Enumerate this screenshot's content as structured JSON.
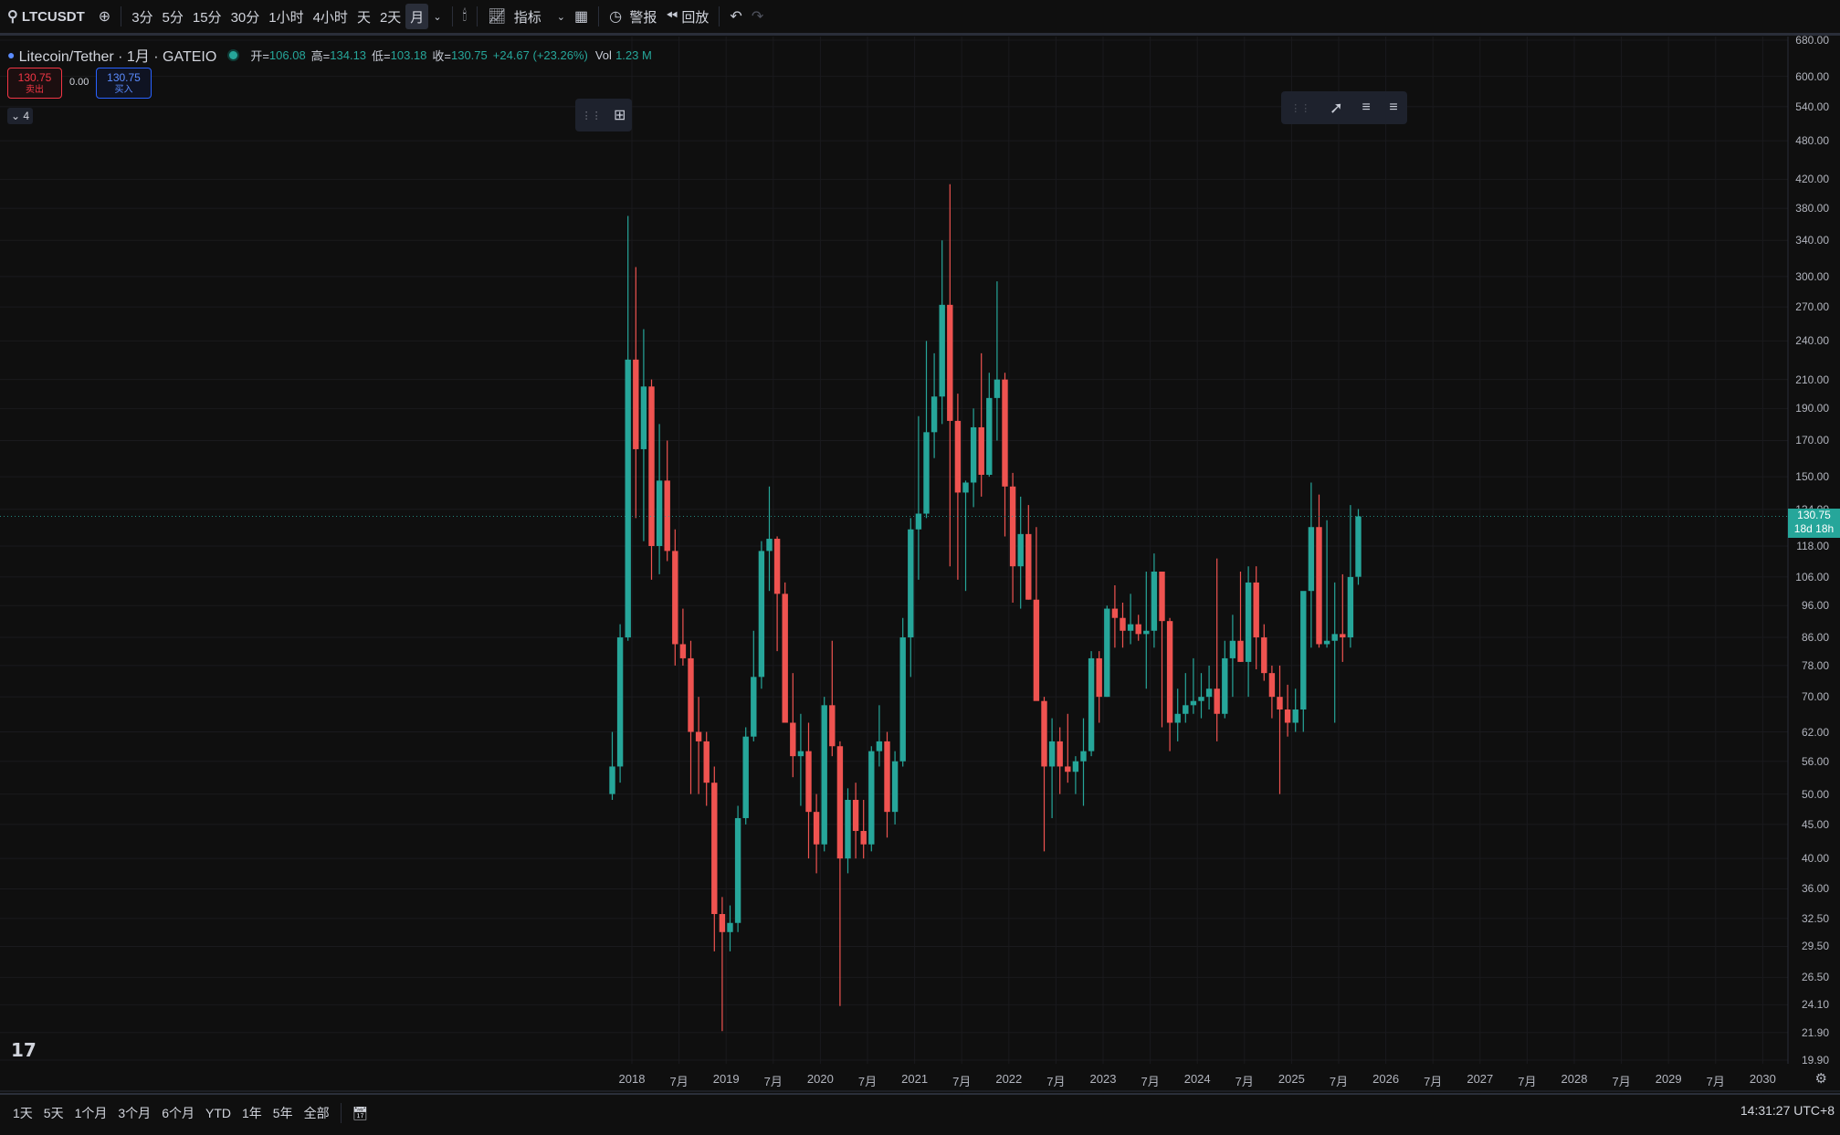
{
  "toolbar": {
    "symbol": "LTCUSDT",
    "intervals": [
      "3分",
      "5分",
      "15分",
      "30分",
      "1小时",
      "4小时",
      "天",
      "2天",
      "月"
    ],
    "active_interval": "月",
    "indicators_label": "指标",
    "alerts_label": "警报",
    "replay_label": "回放"
  },
  "legend": {
    "title": "Litecoin/Tether · 1月 · GATEIO",
    "open_k": "开=",
    "open_v": "106.08",
    "high_k": "高=",
    "high_v": "134.13",
    "low_k": "低=",
    "low_v": "103.18",
    "close_k": "收=",
    "close_v": "130.75",
    "change": "+24.67 (+23.26%)",
    "vol_k": "Vol",
    "vol_v": "1.23 M"
  },
  "trade": {
    "sell_price": "130.75",
    "sell_label": "卖出",
    "spread": "0.00",
    "buy_price": "130.75",
    "buy_label": "买入",
    "collapse_count": "4"
  },
  "price_axis": [
    "680.00",
    "600.00",
    "540.00",
    "480.00",
    "420.00",
    "380.00",
    "340.00",
    "300.00",
    "270.00",
    "240.00",
    "210.00",
    "190.00",
    "170.00",
    "150.00",
    "134.00",
    "118.00",
    "106.00",
    "96.00",
    "86.00",
    "78.00",
    "70.00",
    "62.00",
    "56.00",
    "50.00",
    "45.00",
    "40.00",
    "36.00",
    "32.50",
    "29.50",
    "26.50",
    "24.10",
    "21.90",
    "19.90"
  ],
  "last_price": {
    "price": "130.75",
    "countdown": "18d 18h"
  },
  "time_axis": [
    "2018",
    "7月",
    "2019",
    "7月",
    "2020",
    "7月",
    "2021",
    "7月",
    "2022",
    "7月",
    "2023",
    "7月",
    "2024",
    "7月",
    "2025",
    "7月",
    "2026",
    "7月",
    "2027",
    "7月",
    "2028",
    "7月",
    "2029",
    "7月",
    "2030"
  ],
  "bottom": {
    "ranges": [
      "1天",
      "5天",
      "1个月",
      "3个月",
      "6个月",
      "YTD",
      "1年",
      "5年",
      "全部"
    ],
    "clock": "14:31:27 UTC+8"
  },
  "colors": {
    "up": "#26a69a",
    "down": "#ef5350",
    "bg": "#0f0f0f"
  },
  "chart_data": {
    "type": "candlestick",
    "title": "Litecoin/Tether · 1月 · GATEIO",
    "yscale": "log",
    "ylim": [
      19.9,
      680
    ],
    "candles": [
      {
        "t": "2017-10",
        "o": 50,
        "h": 62,
        "l": 49,
        "c": 55
      },
      {
        "t": "2017-11",
        "o": 55,
        "h": 90,
        "l": 52,
        "c": 86
      },
      {
        "t": "2017-12",
        "o": 86,
        "h": 370,
        "l": 85,
        "c": 225
      },
      {
        "t": "2018-01",
        "o": 225,
        "h": 310,
        "l": 130,
        "c": 165
      },
      {
        "t": "2018-02",
        "o": 165,
        "h": 250,
        "l": 120,
        "c": 205
      },
      {
        "t": "2018-03",
        "o": 205,
        "h": 210,
        "l": 105,
        "c": 118
      },
      {
        "t": "2018-04",
        "o": 118,
        "h": 180,
        "l": 107,
        "c": 148
      },
      {
        "t": "2018-05",
        "o": 148,
        "h": 170,
        "l": 112,
        "c": 116
      },
      {
        "t": "2018-06",
        "o": 116,
        "h": 125,
        "l": 78,
        "c": 84
      },
      {
        "t": "2018-07",
        "o": 84,
        "h": 95,
        "l": 78,
        "c": 80
      },
      {
        "t": "2018-08",
        "o": 80,
        "h": 85,
        "l": 50,
        "c": 62
      },
      {
        "t": "2018-09",
        "o": 62,
        "h": 70,
        "l": 50,
        "c": 60
      },
      {
        "t": "2018-10",
        "o": 60,
        "h": 62,
        "l": 48,
        "c": 52
      },
      {
        "t": "2018-11",
        "o": 52,
        "h": 55,
        "l": 29,
        "c": 33
      },
      {
        "t": "2018-12",
        "o": 33,
        "h": 35,
        "l": 22,
        "c": 31
      },
      {
        "t": "2019-01",
        "o": 31,
        "h": 34,
        "l": 29,
        "c": 32
      },
      {
        "t": "2019-02",
        "o": 32,
        "h": 48,
        "l": 31,
        "c": 46
      },
      {
        "t": "2019-03",
        "o": 46,
        "h": 63,
        "l": 45,
        "c": 61
      },
      {
        "t": "2019-04",
        "o": 61,
        "h": 88,
        "l": 60,
        "c": 75
      },
      {
        "t": "2019-05",
        "o": 75,
        "h": 120,
        "l": 72,
        "c": 116
      },
      {
        "t": "2019-06",
        "o": 116,
        "h": 145,
        "l": 101,
        "c": 121
      },
      {
        "t": "2019-07",
        "o": 121,
        "h": 122,
        "l": 82,
        "c": 100
      },
      {
        "t": "2019-08",
        "o": 100,
        "h": 104,
        "l": 67,
        "c": 64
      },
      {
        "t": "2019-09",
        "o": 64,
        "h": 76,
        "l": 53,
        "c": 57
      },
      {
        "t": "2019-10",
        "o": 57,
        "h": 66,
        "l": 48,
        "c": 58
      },
      {
        "t": "2019-11",
        "o": 58,
        "h": 64,
        "l": 40,
        "c": 47
      },
      {
        "t": "2019-12",
        "o": 47,
        "h": 50,
        "l": 38,
        "c": 42
      },
      {
        "t": "2020-01",
        "o": 42,
        "h": 70,
        "l": 41,
        "c": 68
      },
      {
        "t": "2020-02",
        "o": 68,
        "h": 85,
        "l": 57,
        "c": 59
      },
      {
        "t": "2020-03",
        "o": 59,
        "h": 60,
        "l": 24,
        "c": 40
      },
      {
        "t": "2020-04",
        "o": 40,
        "h": 51,
        "l": 38,
        "c": 49
      },
      {
        "t": "2020-05",
        "o": 49,
        "h": 52,
        "l": 40,
        "c": 44
      },
      {
        "t": "2020-06",
        "o": 44,
        "h": 49,
        "l": 40,
        "c": 42
      },
      {
        "t": "2020-07",
        "o": 42,
        "h": 59,
        "l": 41,
        "c": 58
      },
      {
        "t": "2020-08",
        "o": 58,
        "h": 68,
        "l": 55,
        "c": 60
      },
      {
        "t": "2020-09",
        "o": 60,
        "h": 62,
        "l": 43,
        "c": 47
      },
      {
        "t": "2020-10",
        "o": 47,
        "h": 58,
        "l": 45,
        "c": 56
      },
      {
        "t": "2020-11",
        "o": 56,
        "h": 92,
        "l": 55,
        "c": 86
      },
      {
        "t": "2020-12",
        "o": 86,
        "h": 130,
        "l": 75,
        "c": 125
      },
      {
        "t": "2021-01",
        "o": 125,
        "h": 185,
        "l": 105,
        "c": 132
      },
      {
        "t": "2021-02",
        "o": 132,
        "h": 240,
        "l": 130,
        "c": 175
      },
      {
        "t": "2021-03",
        "o": 175,
        "h": 230,
        "l": 160,
        "c": 198
      },
      {
        "t": "2021-04",
        "o": 198,
        "h": 340,
        "l": 180,
        "c": 272
      },
      {
        "t": "2021-05",
        "o": 272,
        "h": 413,
        "l": 110,
        "c": 182
      },
      {
        "t": "2021-06",
        "o": 182,
        "h": 200,
        "l": 105,
        "c": 142
      },
      {
        "t": "2021-07",
        "o": 142,
        "h": 148,
        "l": 101,
        "c": 147
      },
      {
        "t": "2021-08",
        "o": 147,
        "h": 190,
        "l": 135,
        "c": 178
      },
      {
        "t": "2021-09",
        "o": 178,
        "h": 230,
        "l": 140,
        "c": 151
      },
      {
        "t": "2021-10",
        "o": 151,
        "h": 215,
        "l": 150,
        "c": 197
      },
      {
        "t": "2021-11",
        "o": 197,
        "h": 295,
        "l": 170,
        "c": 210
      },
      {
        "t": "2021-12",
        "o": 210,
        "h": 215,
        "l": 122,
        "c": 145
      },
      {
        "t": "2022-01",
        "o": 145,
        "h": 152,
        "l": 97,
        "c": 110
      },
      {
        "t": "2022-02",
        "o": 110,
        "h": 140,
        "l": 95,
        "c": 123
      },
      {
        "t": "2022-03",
        "o": 123,
        "h": 136,
        "l": 98,
        "c": 98
      },
      {
        "t": "2022-04",
        "o": 98,
        "h": 126,
        "l": 91,
        "c": 69
      },
      {
        "t": "2022-05",
        "o": 69,
        "h": 70,
        "l": 41,
        "c": 55
      },
      {
        "t": "2022-06",
        "o": 55,
        "h": 65,
        "l": 46,
        "c": 60
      },
      {
        "t": "2022-07",
        "o": 60,
        "h": 63,
        "l": 50,
        "c": 55
      },
      {
        "t": "2022-08",
        "o": 55,
        "h": 66,
        "l": 52,
        "c": 54
      },
      {
        "t": "2022-09",
        "o": 54,
        "h": 57,
        "l": 50,
        "c": 56
      },
      {
        "t": "2022-10",
        "o": 56,
        "h": 65,
        "l": 48,
        "c": 58
      },
      {
        "t": "2022-11",
        "o": 58,
        "h": 82,
        "l": 57,
        "c": 80
      },
      {
        "t": "2022-12",
        "o": 80,
        "h": 82,
        "l": 64,
        "c": 70
      },
      {
        "t": "2023-01",
        "o": 70,
        "h": 96,
        "l": 70,
        "c": 95
      },
      {
        "t": "2023-02",
        "o": 95,
        "h": 103,
        "l": 83,
        "c": 92
      },
      {
        "t": "2023-03",
        "o": 92,
        "h": 97,
        "l": 83,
        "c": 88
      },
      {
        "t": "2023-04",
        "o": 88,
        "h": 100,
        "l": 84,
        "c": 90
      },
      {
        "t": "2023-05",
        "o": 90,
        "h": 93,
        "l": 85,
        "c": 87
      },
      {
        "t": "2023-06",
        "o": 87,
        "h": 108,
        "l": 72,
        "c": 88
      },
      {
        "t": "2023-07",
        "o": 88,
        "h": 115,
        "l": 83,
        "c": 108
      },
      {
        "t": "2023-08",
        "o": 108,
        "h": 108,
        "l": 63,
        "c": 91
      },
      {
        "t": "2023-09",
        "o": 91,
        "h": 92,
        "l": 58,
        "c": 64
      },
      {
        "t": "2023-10",
        "o": 64,
        "h": 72,
        "l": 60,
        "c": 66
      },
      {
        "t": "2023-11",
        "o": 66,
        "h": 76,
        "l": 64,
        "c": 68
      },
      {
        "t": "2023-12",
        "o": 68,
        "h": 80,
        "l": 66,
        "c": 69
      },
      {
        "t": "2024-01",
        "o": 69,
        "h": 76,
        "l": 65,
        "c": 70
      },
      {
        "t": "2024-02",
        "o": 70,
        "h": 78,
        "l": 67,
        "c": 72
      },
      {
        "t": "2024-03",
        "o": 72,
        "h": 113,
        "l": 60,
        "c": 66
      },
      {
        "t": "2024-04",
        "o": 66,
        "h": 85,
        "l": 65,
        "c": 80
      },
      {
        "t": "2024-05",
        "o": 80,
        "h": 93,
        "l": 70,
        "c": 85
      },
      {
        "t": "2024-06",
        "o": 85,
        "h": 108,
        "l": 79,
        "c": 79
      },
      {
        "t": "2024-07",
        "o": 79,
        "h": 110,
        "l": 70,
        "c": 104
      },
      {
        "t": "2024-08",
        "o": 104,
        "h": 110,
        "l": 77,
        "c": 86
      },
      {
        "t": "2024-09",
        "o": 86,
        "h": 90,
        "l": 74,
        "c": 76
      },
      {
        "t": "2024-10",
        "o": 76,
        "h": 78,
        "l": 65,
        "c": 70
      },
      {
        "t": "2024-11",
        "o": 70,
        "h": 78,
        "l": 50,
        "c": 67
      },
      {
        "t": "2024-12",
        "o": 67,
        "h": 73,
        "l": 61,
        "c": 64
      },
      {
        "t": "2025-01",
        "o": 64,
        "h": 72,
        "l": 62,
        "c": 67
      },
      {
        "t": "2025-02",
        "o": 67,
        "h": 99,
        "l": 62,
        "c": 101
      },
      {
        "t": "2025-03",
        "o": 101,
        "h": 147,
        "l": 83,
        "c": 126
      },
      {
        "t": "2025-04",
        "o": 126,
        "h": 141,
        "l": 83,
        "c": 84
      },
      {
        "t": "2025-05",
        "o": 84,
        "h": 129,
        "l": 83,
        "c": 85
      },
      {
        "t": "2025-06",
        "o": 85,
        "h": 104,
        "l": 64,
        "c": 87
      },
      {
        "t": "2025-07",
        "o": 87,
        "h": 107,
        "l": 79,
        "c": 86
      },
      {
        "t": "2025-08",
        "o": 86,
        "h": 136,
        "l": 83,
        "c": 106
      },
      {
        "t": "2025-09",
        "o": 106.08,
        "h": 134.13,
        "l": 103.18,
        "c": 130.75
      }
    ]
  }
}
